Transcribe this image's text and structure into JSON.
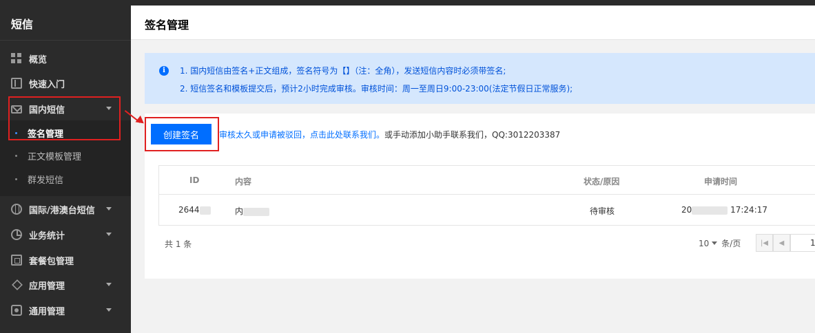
{
  "sidebar": {
    "title": "短信",
    "items": [
      {
        "label": "概览",
        "icon": "grid-icon"
      },
      {
        "label": "快速入门",
        "icon": "book-icon"
      },
      {
        "label": "国内短信",
        "icon": "mail-icon"
      },
      {
        "label": "国际/港澳台短信",
        "icon": "globe-icon"
      },
      {
        "label": "业务统计",
        "icon": "pie-chart-icon"
      },
      {
        "label": "套餐包管理",
        "icon": "package-icon"
      },
      {
        "label": "应用管理",
        "icon": "layers-icon"
      },
      {
        "label": "通用管理",
        "icon": "settings-icon"
      }
    ],
    "sub_items": [
      {
        "label": "签名管理"
      },
      {
        "label": "正文模板管理"
      },
      {
        "label": "群发短信"
      }
    ]
  },
  "header": {
    "title": "签名管理"
  },
  "notice": {
    "line1": "1. 国内短信由签名+正文组成，签名符号为【】（注：全角），发送短信内容时必须带签名;",
    "line2": "2. 短信签名和模板提交后，预计2小时完成审核。审核时间：周一至周日9:00-23:00(法定节假日正常服务);"
  },
  "toolbar": {
    "create_label": "创建签名",
    "tip_link": "审核太久或申请被驳回，点击此处联系我们。",
    "tip_text": "或手动添加小助手联系我们，QQ:3012203387"
  },
  "table": {
    "headers": {
      "id": "ID",
      "content": "内容",
      "status": "状态/原因",
      "time": "申请时间"
    },
    "rows": [
      {
        "id": "2644",
        "content": "内",
        "status": "待审核",
        "time_prefix": "20",
        "time_suffix": "17:24:17"
      }
    ]
  },
  "pagination": {
    "total": "共 1 条",
    "page_size": "10",
    "page_size_unit": "条/页",
    "current_page": "1"
  },
  "colors": {
    "primary": "#006eff",
    "notice_bg": "#d5e7fd",
    "highlight": "#e02020",
    "sidebar_bg": "#2b2b2b"
  }
}
